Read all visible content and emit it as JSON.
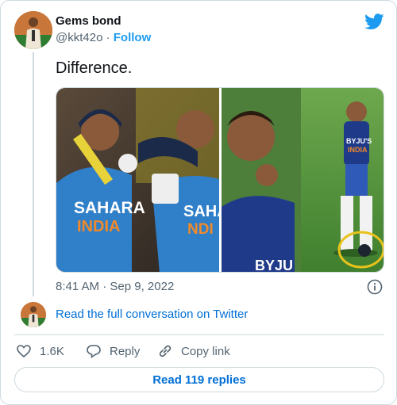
{
  "author": {
    "name": "Gems bond",
    "handle": "@kkt42o",
    "follow_label": "Follow"
  },
  "tweet": {
    "text": "Difference.",
    "time": "8:41 AM",
    "date": "Sep 9, 2022",
    "media": {
      "left_jersey_text": "SAHARA",
      "left_jersey_sub": "INDIA",
      "right_jersey_text": "BYJU'S",
      "right_jersey_sub": "INDIA"
    }
  },
  "conversation_link": "Read the full conversation on Twitter",
  "actions": {
    "like_count": "1.6K",
    "reply_label": "Reply",
    "copy_label": "Copy link"
  },
  "read_replies_label": "Read 119 replies",
  "colors": {
    "accent": "#1d9bf0",
    "link": "#006fd6",
    "muted": "#536471",
    "border": "#cfd9de"
  },
  "icons": [
    "twitter-bird-icon",
    "info-icon",
    "heart-icon",
    "reply-icon",
    "link-icon"
  ]
}
